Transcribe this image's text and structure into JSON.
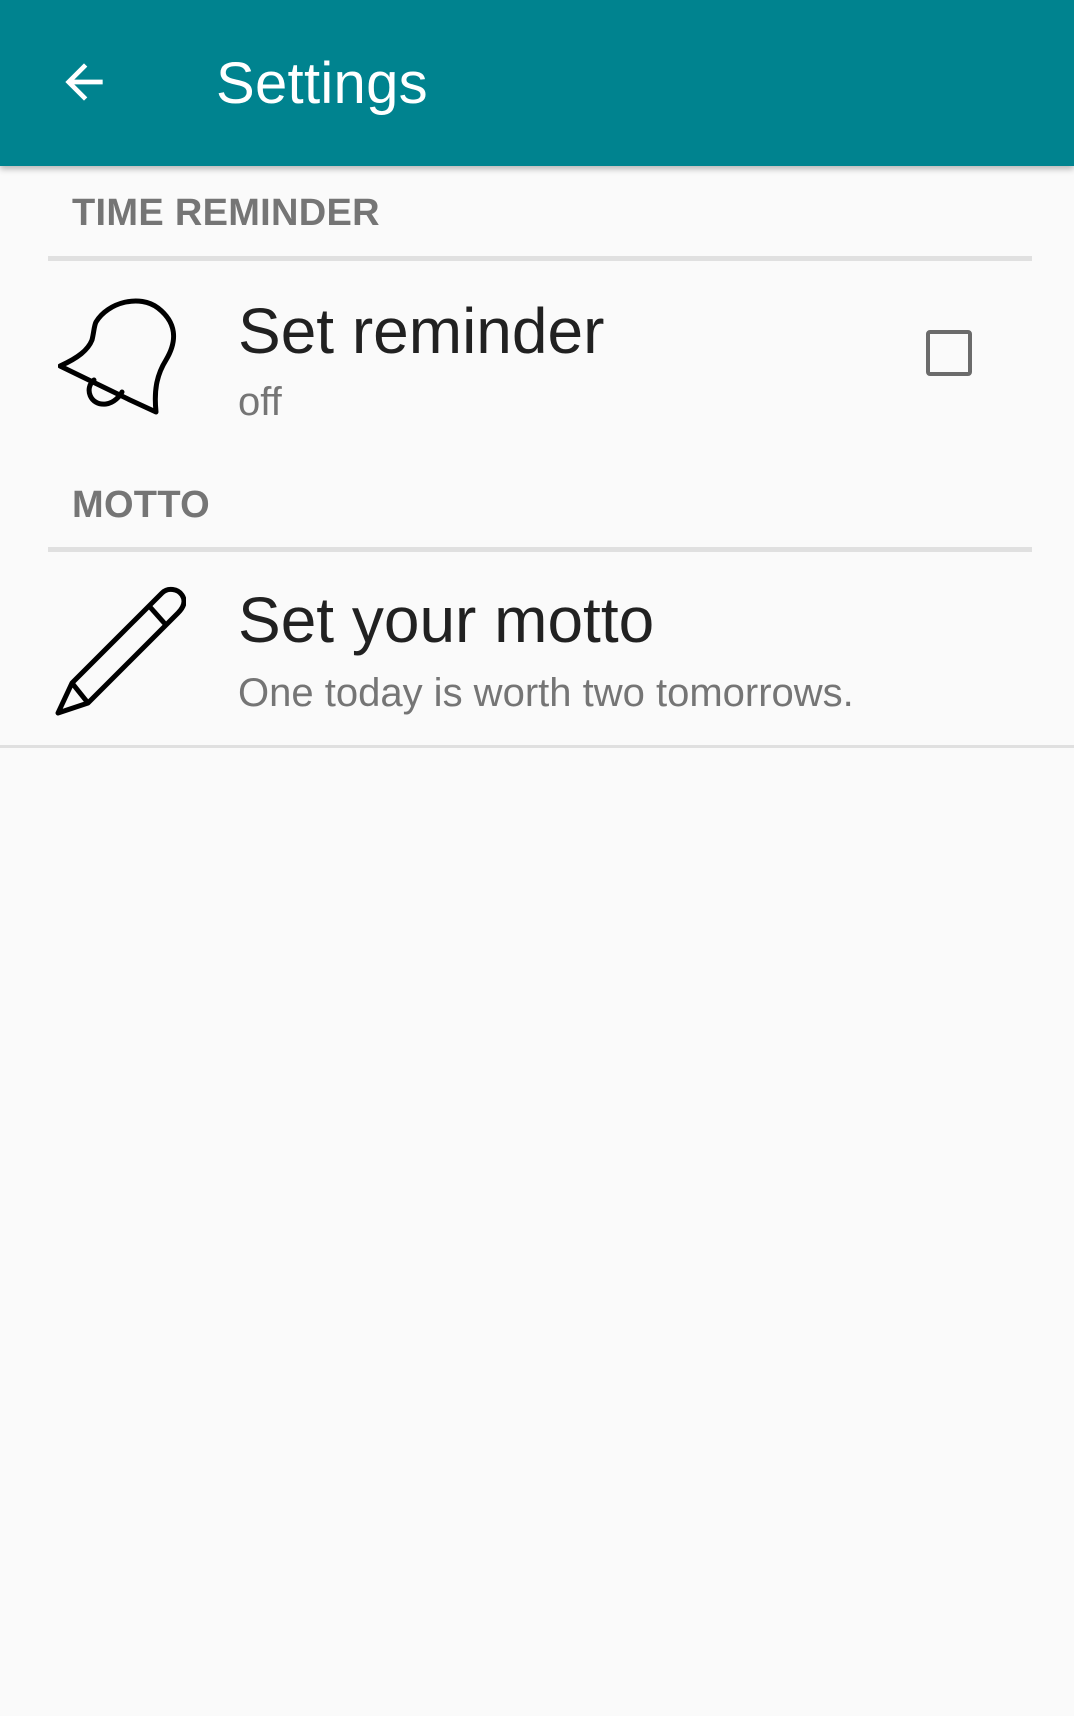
{
  "app_bar": {
    "title": "Settings",
    "back_icon": "arrow-back-icon",
    "color": "#00838f"
  },
  "categories": [
    {
      "header": "TIME REMINDER",
      "preferences": [
        {
          "title": "Set reminder",
          "summary": "off",
          "icon": "bell-icon",
          "widget": "checkbox",
          "checked": false
        }
      ]
    },
    {
      "header": "MOTTO",
      "preferences": [
        {
          "title": "Set your motto",
          "summary": "One today is worth two tomorrows.",
          "icon": "pencil-icon"
        }
      ]
    }
  ]
}
